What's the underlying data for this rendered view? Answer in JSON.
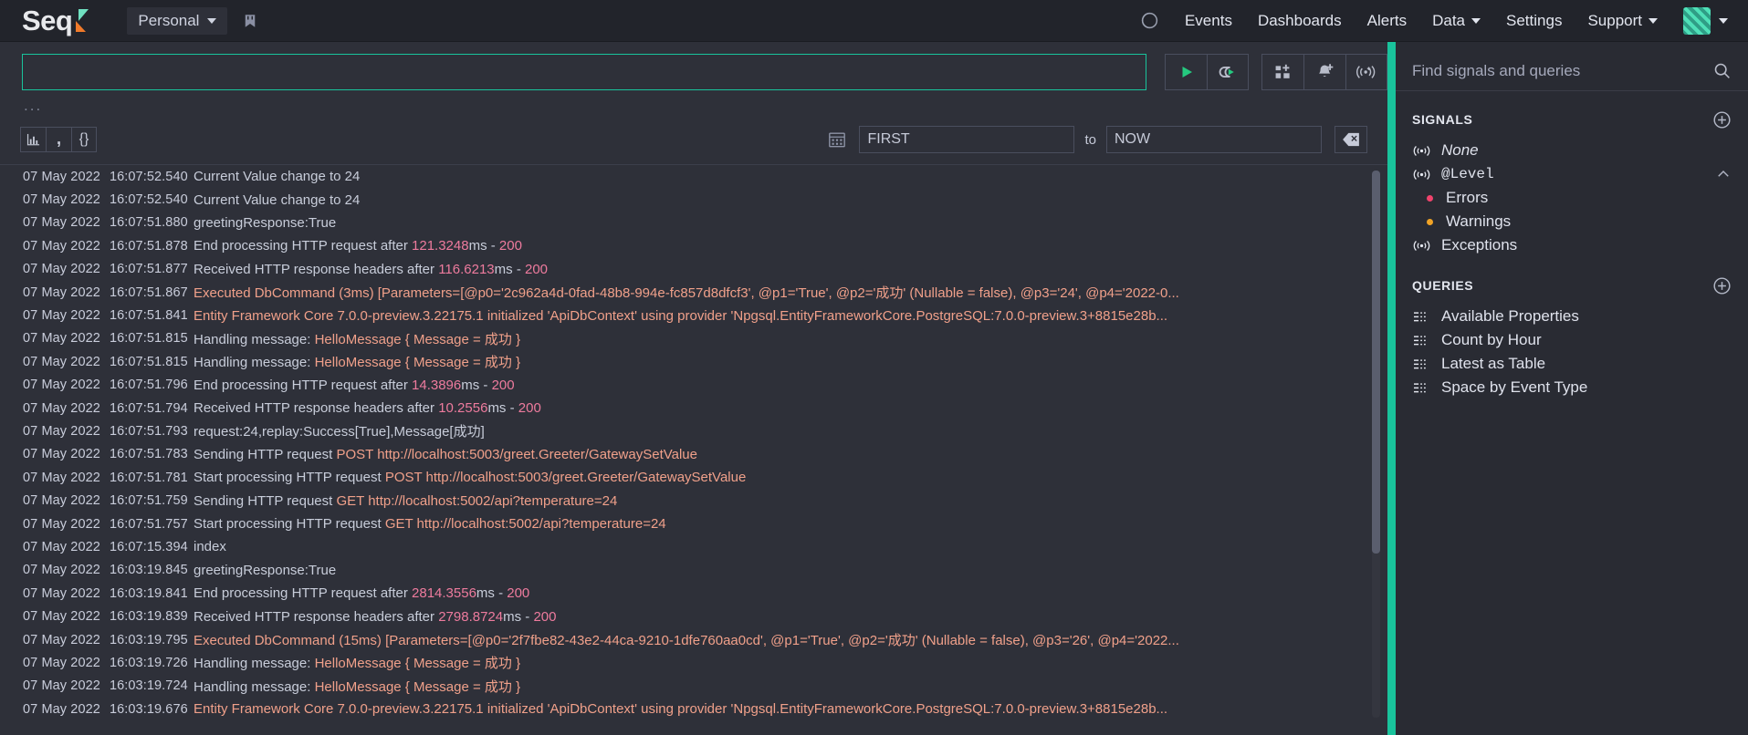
{
  "nav": {
    "brand": "Seq",
    "workspace": "Personal",
    "pin_icon": "bookmark-icon",
    "theme_icon": "moon-icon",
    "links": [
      {
        "label": "Events",
        "caret": false
      },
      {
        "label": "Dashboards",
        "caret": false
      },
      {
        "label": "Alerts",
        "caret": false
      },
      {
        "label": "Data",
        "caret": true
      },
      {
        "label": "Settings",
        "caret": false
      },
      {
        "label": "Support",
        "caret": true
      }
    ],
    "avatar": "user-avatar"
  },
  "search": {
    "query_value": "",
    "query_placeholder": "",
    "ellipsis": "...",
    "buttons": [
      {
        "name": "run-query-button",
        "icon": "play-icon"
      },
      {
        "name": "tail-query-button",
        "icon": "loop-play-icon"
      },
      {
        "name": "add-to-dashboard-button",
        "icon": "grid-plus-icon"
      },
      {
        "name": "create-alert-button",
        "icon": "bell-plus-icon"
      },
      {
        "name": "create-signal-button",
        "icon": "signal-plus-icon"
      }
    ]
  },
  "viewtools": [
    {
      "name": "chart-view-button",
      "icon": "bar-chart-icon"
    },
    {
      "name": "raw-view-button",
      "icon": "comma-icon"
    },
    {
      "name": "json-view-button",
      "icon": "braces-icon"
    }
  ],
  "timefilter": {
    "calendar_icon": "calendar-icon",
    "from_value": "FIRST",
    "from_placeholder": "FIRST",
    "to_label": "to",
    "to_value": "NOW",
    "to_placeholder": "NOW",
    "clear_icon": "backspace-icon"
  },
  "events": [
    {
      "date": "07 May 2022",
      "time": "16:07:52.540",
      "parts": [
        {
          "t": "Current Value change to 24",
          "c": "p"
        }
      ]
    },
    {
      "date": "07 May 2022",
      "time": "16:07:52.540",
      "parts": [
        {
          "t": "Current Value change to 24",
          "c": "p"
        }
      ]
    },
    {
      "date": "07 May 2022",
      "time": "16:07:51.880",
      "parts": [
        {
          "t": "greetingResponse:True",
          "c": "p"
        }
      ]
    },
    {
      "date": "07 May 2022",
      "time": "16:07:51.878",
      "parts": [
        {
          "t": "End processing HTTP request after ",
          "c": "p"
        },
        {
          "t": "121.3248",
          "c": "num"
        },
        {
          "t": "ms - ",
          "c": "p"
        },
        {
          "t": "200",
          "c": "num"
        }
      ]
    },
    {
      "date": "07 May 2022",
      "time": "16:07:51.877",
      "parts": [
        {
          "t": "Received HTTP response headers after ",
          "c": "p"
        },
        {
          "t": "116.6213",
          "c": "num"
        },
        {
          "t": "ms - ",
          "c": "p"
        },
        {
          "t": "200",
          "c": "num"
        }
      ]
    },
    {
      "date": "07 May 2022",
      "time": "16:07:51.867",
      "parts": [
        {
          "t": "Executed DbCommand (3ms) [Parameters=[@p0=",
          "c": "tok"
        },
        {
          "t": "'2c962a4d-0fad-48b8-994e-fc857d8dfcf3', @p1='True', @p2='成功' (Nullable = false), @p3='24', @p4='2022-0...",
          "c": "tok"
        }
      ]
    },
    {
      "date": "07 May 2022",
      "time": "16:07:51.841",
      "parts": [
        {
          "t": "Entity Framework Core 7.0.0-preview.3.22175.1 initialized 'ApiDbContext' using provider 'Npgsql.EntityFrameworkCore.PostgreSQL:7.0.0-preview.3+8815e28b...",
          "c": "tok"
        }
      ]
    },
    {
      "date": "07 May 2022",
      "time": "16:07:51.815",
      "parts": [
        {
          "t": "Handling message: ",
          "c": "p"
        },
        {
          "t": "HelloMessage { Message = 成功 }",
          "c": "tok"
        }
      ]
    },
    {
      "date": "07 May 2022",
      "time": "16:07:51.815",
      "parts": [
        {
          "t": "Handling message: ",
          "c": "p"
        },
        {
          "t": "HelloMessage { Message = 成功 }",
          "c": "tok"
        }
      ]
    },
    {
      "date": "07 May 2022",
      "time": "16:07:51.796",
      "parts": [
        {
          "t": "End processing HTTP request after ",
          "c": "p"
        },
        {
          "t": "14.3896",
          "c": "num"
        },
        {
          "t": "ms - ",
          "c": "p"
        },
        {
          "t": "200",
          "c": "num"
        }
      ]
    },
    {
      "date": "07 May 2022",
      "time": "16:07:51.794",
      "parts": [
        {
          "t": "Received HTTP response headers after ",
          "c": "p"
        },
        {
          "t": "10.2556",
          "c": "num"
        },
        {
          "t": "ms - ",
          "c": "p"
        },
        {
          "t": "200",
          "c": "num"
        }
      ]
    },
    {
      "date": "07 May 2022",
      "time": "16:07:51.793",
      "parts": [
        {
          "t": "request:24,replay:Success[True],Message[成功]",
          "c": "p"
        }
      ]
    },
    {
      "date": "07 May 2022",
      "time": "16:07:51.783",
      "parts": [
        {
          "t": "Sending HTTP request ",
          "c": "p"
        },
        {
          "t": "POST http://localhost:5003/greet.Greeter/GatewaySetValue",
          "c": "tok"
        }
      ]
    },
    {
      "date": "07 May 2022",
      "time": "16:07:51.781",
      "parts": [
        {
          "t": "Start processing HTTP request ",
          "c": "p"
        },
        {
          "t": "POST http://localhost:5003/greet.Greeter/GatewaySetValue",
          "c": "tok"
        }
      ]
    },
    {
      "date": "07 May 2022",
      "time": "16:07:51.759",
      "parts": [
        {
          "t": "Sending HTTP request ",
          "c": "p"
        },
        {
          "t": "GET http://localhost:5002/api?temperature=24",
          "c": "tok"
        }
      ]
    },
    {
      "date": "07 May 2022",
      "time": "16:07:51.757",
      "parts": [
        {
          "t": "Start processing HTTP request ",
          "c": "p"
        },
        {
          "t": "GET http://localhost:5002/api?temperature=24",
          "c": "tok"
        }
      ]
    },
    {
      "date": "07 May 2022",
      "time": "16:07:15.394",
      "parts": [
        {
          "t": "index",
          "c": "p"
        }
      ]
    },
    {
      "date": "07 May 2022",
      "time": "16:03:19.845",
      "parts": [
        {
          "t": "greetingResponse:True",
          "c": "p"
        }
      ]
    },
    {
      "date": "07 May 2022",
      "time": "16:03:19.841",
      "parts": [
        {
          "t": "End processing HTTP request after ",
          "c": "p"
        },
        {
          "t": "2814.3556",
          "c": "num"
        },
        {
          "t": "ms - ",
          "c": "p"
        },
        {
          "t": "200",
          "c": "num"
        }
      ]
    },
    {
      "date": "07 May 2022",
      "time": "16:03:19.839",
      "parts": [
        {
          "t": "Received HTTP response headers after ",
          "c": "p"
        },
        {
          "t": "2798.8724",
          "c": "num"
        },
        {
          "t": "ms - ",
          "c": "p"
        },
        {
          "t": "200",
          "c": "num"
        }
      ]
    },
    {
      "date": "07 May 2022",
      "time": "16:03:19.795",
      "parts": [
        {
          "t": "Executed DbCommand (15ms) [Parameters=[@p0='2f7fbe82-43e2-44ca-9210-1dfe760aa0cd', @p1='True', @p2='成功' (Nullable = false), @p3='26', @p4='2022...",
          "c": "tok"
        }
      ]
    },
    {
      "date": "07 May 2022",
      "time": "16:03:19.726",
      "parts": [
        {
          "t": "Handling message: ",
          "c": "p"
        },
        {
          "t": "HelloMessage { Message = 成功 }",
          "c": "tok"
        }
      ]
    },
    {
      "date": "07 May 2022",
      "time": "16:03:19.724",
      "parts": [
        {
          "t": "Handling message: ",
          "c": "p"
        },
        {
          "t": "HelloMessage { Message = 成功 }",
          "c": "tok"
        }
      ]
    },
    {
      "date": "07 May 2022",
      "time": "16:03:19.676",
      "parts": [
        {
          "t": "Entity Framework Core 7.0.0-preview.3.22175.1 initialized 'ApiDbContext' using provider 'Npgsql.EntityFrameworkCore.PostgreSQL:7.0.0-preview.3+8815e28b...",
          "c": "tok"
        }
      ]
    }
  ],
  "panel": {
    "find_placeholder": "Find signals and queries",
    "find_value": "",
    "signals_title": "SIGNALS",
    "queries_title": "QUERIES",
    "signals": [
      {
        "label": "None",
        "icon": "signal-icon",
        "italic": true
      },
      {
        "label": "@Level",
        "icon": "signal-icon",
        "mono": true,
        "caret": "chevron-up-icon"
      }
    ],
    "levels": [
      {
        "label": "Errors",
        "color": "#f0436c"
      },
      {
        "label": "Warnings",
        "color": "#f0a326"
      }
    ],
    "exceptions": {
      "label": "Exceptions",
      "icon": "signal-icon"
    },
    "queries": [
      {
        "label": "Available Properties",
        "icon": "query-icon"
      },
      {
        "label": "Count by Hour",
        "icon": "query-icon"
      },
      {
        "label": "Latest as Table",
        "icon": "query-icon"
      },
      {
        "label": "Space by Event Type",
        "icon": "query-icon"
      }
    ]
  },
  "colors": {
    "accent": "#19c39c",
    "background": "#2e3039",
    "navbar": "#22242b",
    "panel": "#292b33",
    "error": "#f0436c",
    "warning": "#f0a326",
    "number": "#ee7b9e",
    "token": "#f0a08a"
  }
}
